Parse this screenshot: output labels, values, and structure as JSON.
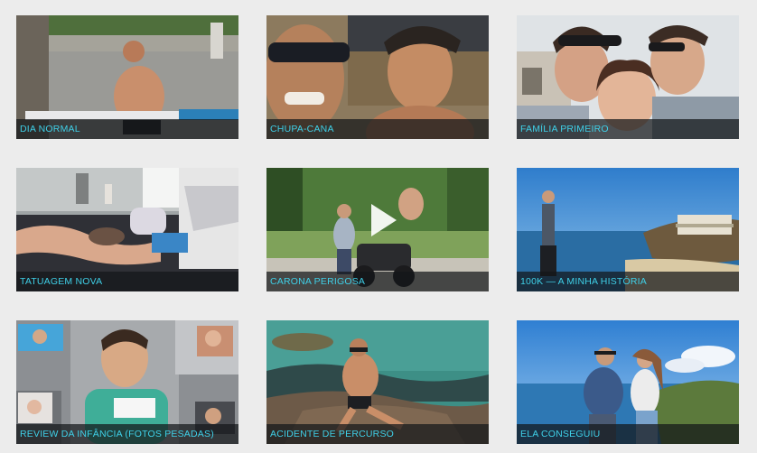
{
  "videos": [
    {
      "title": "DIA NORMAL"
    },
    {
      "title": "CHUPA-CANA"
    },
    {
      "title": "FAMÍLIA PRIMEIRO"
    },
    {
      "title": "TATUAGEM NOVA"
    },
    {
      "title": "CARONA PERIGOSA"
    },
    {
      "title": "100K — A MINHA HISTÓRIA"
    },
    {
      "title": "REVIEW DA INFÂNCIA (FOTOS PESADAS)"
    },
    {
      "title": "ACIDENTE DE PERCURSO"
    },
    {
      "title": "ELA CONSEGUIU"
    }
  ],
  "accent_color": "#3fd0e8",
  "play_icon": "play-icon"
}
